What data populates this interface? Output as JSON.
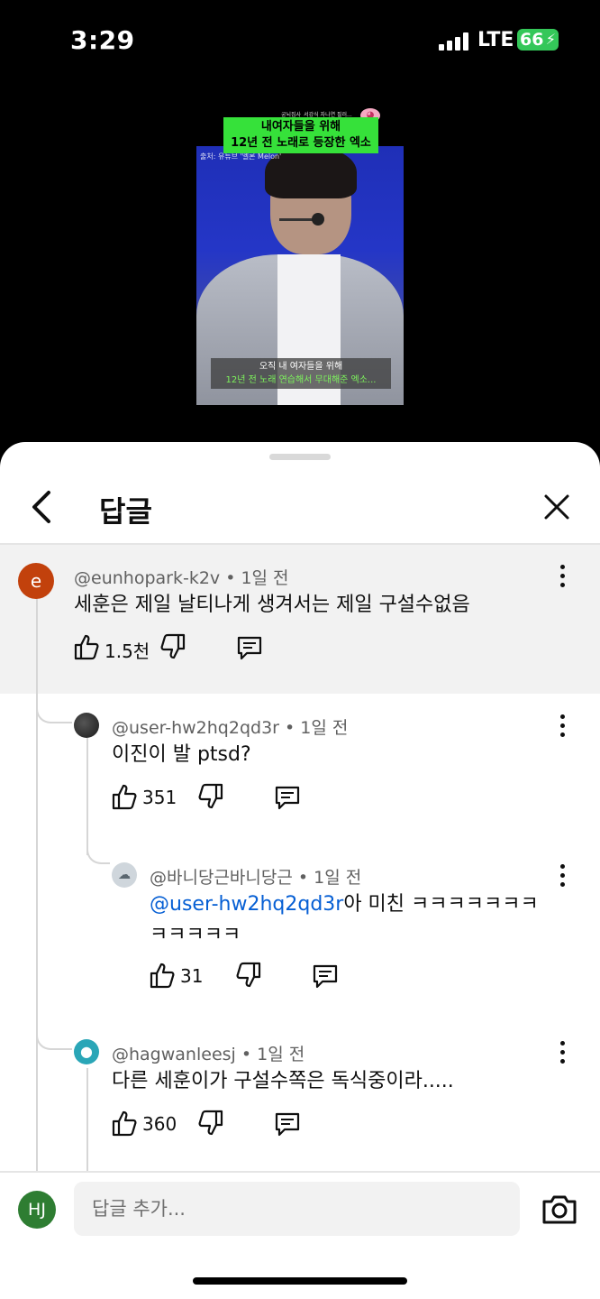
{
  "status_bar": {
    "time": "3:29",
    "network": "LTE",
    "battery": "66"
  },
  "video": {
    "title_line1": "내여자들을 위해",
    "title_line2": "12년 전 노래로 등장한 엑소",
    "tiny_caption": "궁뇌집사_서강식 자나연 필러...",
    "source": "출처: 유튜브 '멜론 Melon'",
    "subtitle_line1": "오직 내 여자들을 위해",
    "subtitle_line2": "12년 전 노래 연습해서 무대해준 엑소..."
  },
  "sheet": {
    "title": "답글"
  },
  "comments": [
    {
      "avatar_letter": "e",
      "avatar_color": "#c2410c",
      "author": "@eunhopark-k2v",
      "time": "1일 전",
      "text": "세훈은 제일 날티나게 생겨서는 제일 구설수없음",
      "likes": "1.5천"
    },
    {
      "avatar_color": "#2b2b2b",
      "author": "@user-hw2hq2qd3r",
      "time": "1일 전",
      "text": "이진이 발 ptsd?",
      "likes": "351"
    },
    {
      "avatar_color": "#cfd6dc",
      "author": "@바니당근바니당근",
      "time": "1일 전",
      "mention": "@user-hw2hq2qd3r",
      "text": "아 미친 ㅋㅋㅋㅋㅋㅋㅋ",
      "text_line2": "ㅋㅋㅋㅋㅋ",
      "likes": "31"
    },
    {
      "avatar_color": "#2aa6b7",
      "author": "@hagwanleesj",
      "time": "1일 전",
      "text": "다른 세훈이가 구설수쪽은 독식중이라.....",
      "likes": "360"
    }
  ],
  "input": {
    "avatar_initials": "HJ",
    "placeholder": "답글 추가..."
  }
}
